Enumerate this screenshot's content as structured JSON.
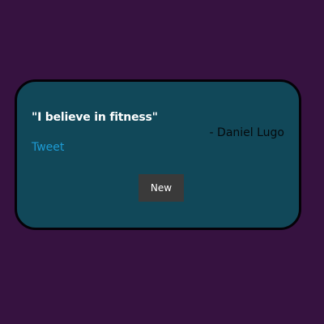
{
  "quote": {
    "text": "\"I believe in fitness\"",
    "author": "- Daniel Lugo"
  },
  "actions": {
    "tweet_label": "Tweet",
    "new_label": "New"
  },
  "colors": {
    "page_background": "#361240",
    "card_background": "#114859",
    "card_border": "#050208",
    "tweet_link": "#1d9bd4",
    "button_background": "#3a3a3a"
  }
}
